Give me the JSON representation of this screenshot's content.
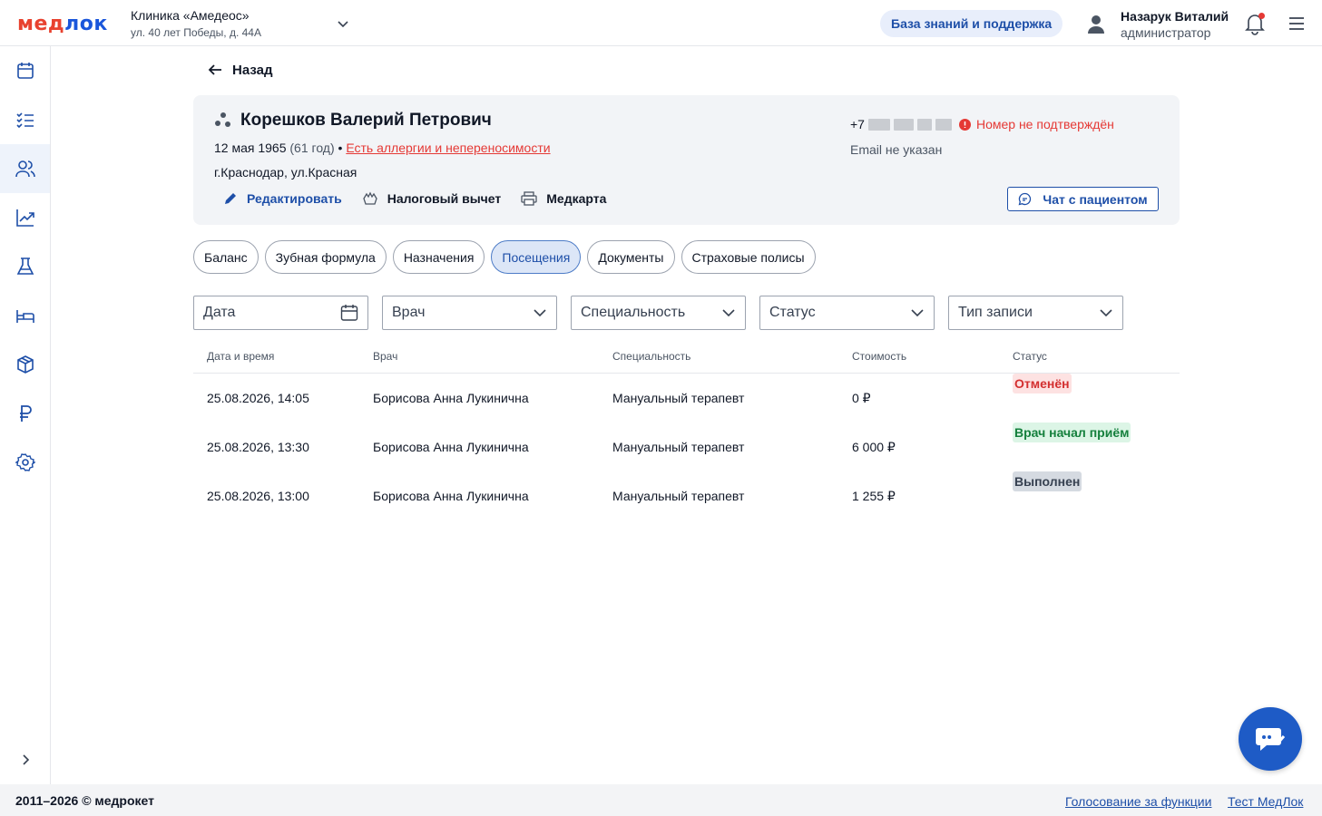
{
  "header": {
    "logo_left": "мед",
    "logo_right": "лок",
    "clinic_name": "Клиника «Амедеос»",
    "clinic_address": "ул. 40 лет Победы, д. 44А",
    "kb_button": "База знаний и поддержка",
    "user_name": "Назарук Виталий",
    "user_role": "администратор"
  },
  "sidebar": {
    "items": [
      "calendar-icon",
      "tasks-icon",
      "patients-icon",
      "analytics-icon",
      "lab-icon",
      "bed-icon",
      "box-icon",
      "ruble-icon",
      "settings-icon"
    ],
    "active_index": 2
  },
  "back_label": "Назад",
  "patient": {
    "name": "Корешков Валерий Петрович",
    "birth_date": "12 мая 1965",
    "age": "(61 год)",
    "separator": "•",
    "allergy_link": "Есть аллергии и непереносимости",
    "address": "г.Краснодар, ул.Красная",
    "phone_prefix": "+7",
    "phone_status": "Номер не подтверждён",
    "email": "Email не указан",
    "actions": {
      "edit": "Редактировать",
      "tax": "Налоговый вычет",
      "medcard": "Медкарта"
    },
    "chat_button": "Чат с пациентом"
  },
  "tabs": [
    {
      "label": "Баланс",
      "active": false
    },
    {
      "label": "Зубная формула",
      "active": false
    },
    {
      "label": "Назначения",
      "active": false
    },
    {
      "label": "Посещения",
      "active": true
    },
    {
      "label": "Документы",
      "active": false
    },
    {
      "label": "Страховые полисы",
      "active": false
    }
  ],
  "filters": {
    "date": "Дата",
    "doctor": "Врач",
    "specialty": "Специальность",
    "status": "Статус",
    "record_type": "Тип записи"
  },
  "table": {
    "headers": [
      "Дата и время",
      "Врач",
      "Специальность",
      "Стоимость",
      "Статус"
    ],
    "rows": [
      {
        "datetime": "25.08.2026, 14:05",
        "doctor": "Борисова Анна Лукинична",
        "specialty": "Мануальный терапевт",
        "cost": "0 ₽",
        "status": "Отменён"
      },
      {
        "datetime": "25.08.2026, 13:30",
        "doctor": "Борисова Анна Лукинична",
        "specialty": "Мануальный терапевт",
        "cost": "6 000 ₽",
        "status": "Врач начал приём"
      },
      {
        "datetime": "25.08.2026, 13:00",
        "doctor": "Борисова Анна Лукинична",
        "specialty": "Мануальный терапевт",
        "cost": "1 255 ₽",
        "status": "Выполнен"
      }
    ]
  },
  "footer": {
    "copyright": "2011–2026 © медрокет",
    "vote_link": "Голосование за функции",
    "test_link": "Тест МедЛок"
  },
  "colors": {
    "accent": "#1e4fa8",
    "danger": "#e53935",
    "success": "#15803d"
  }
}
